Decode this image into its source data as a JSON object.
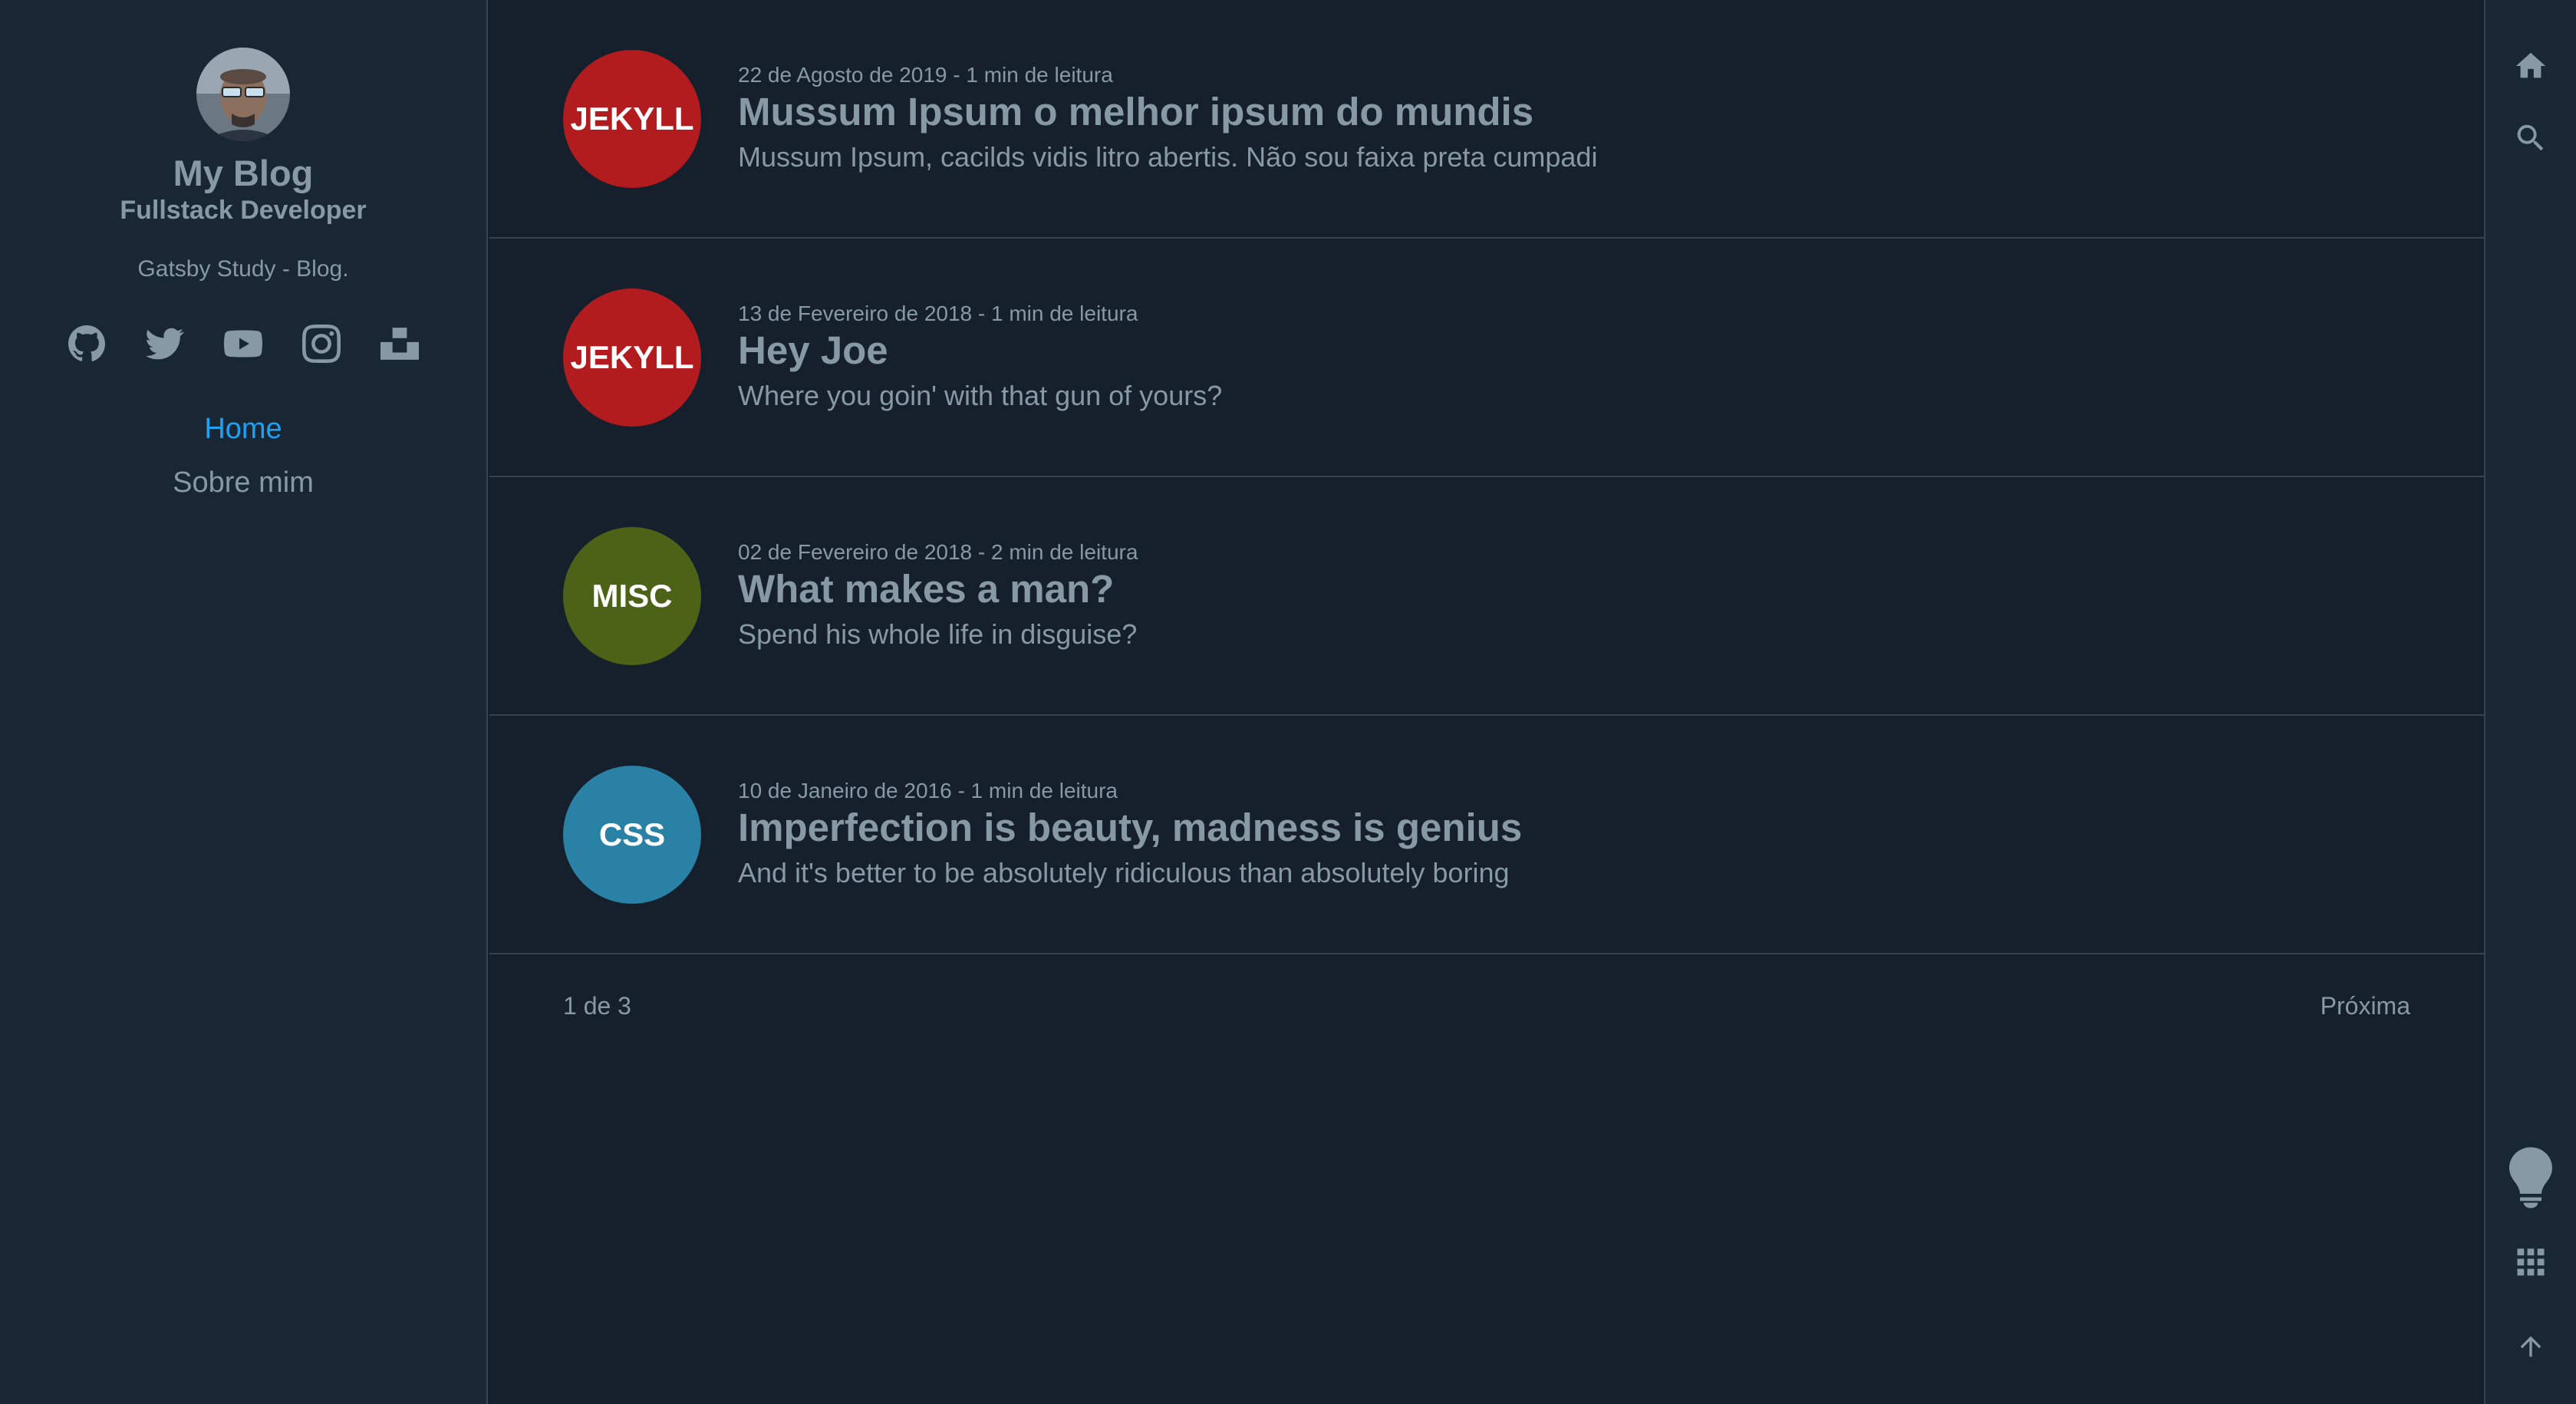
{
  "sidebar": {
    "title": "My Blog",
    "position": "Fullstack Developer",
    "description": "Gatsby Study - Blog.",
    "social": [
      "github-icon",
      "twitter-icon",
      "youtube-icon",
      "instagram-icon",
      "unsplash-icon"
    ],
    "menu": [
      {
        "label": "Home",
        "active": true
      },
      {
        "label": "Sobre mim",
        "active": false
      }
    ]
  },
  "posts": [
    {
      "tag": "JEKYLL",
      "color": "#b21c1f",
      "date": "22 de Agosto de 2019 - 1 min de leitura",
      "title": "Mussum Ipsum o melhor ipsum do mundis",
      "description": "Mussum Ipsum, cacilds vidis litro abertis. Não sou faixa preta cumpadi"
    },
    {
      "tag": "JEKYLL",
      "color": "#b21c1f",
      "date": "13 de Fevereiro de 2018 - 1 min de leitura",
      "title": "Hey Joe",
      "description": "Where you goin' with that gun of yours?"
    },
    {
      "tag": "MISC",
      "color": "#4b6217",
      "date": "02 de Fevereiro de 2018 - 2 min de leitura",
      "title": "What makes a man?",
      "description": "Spend his whole life in disguise?"
    },
    {
      "tag": "CSS",
      "color": "#2981a6",
      "date": "10 de Janeiro de 2016 - 1 min de leitura",
      "title": "Imperfection is beauty, madness is genius",
      "description": "And it's better to be absolutely ridiculous than absolutely boring"
    }
  ],
  "pagination": {
    "page_info": "1 de 3",
    "next_label": "Próxima"
  },
  "menubar": {
    "top": [
      "home-icon",
      "search-icon"
    ],
    "bottom": [
      "lightbulb-icon",
      "grid-icon",
      "arrow-up-icon"
    ]
  },
  "colors": {
    "background": "#16202c",
    "sidebar": "#192734",
    "text": "#8899a6",
    "highlight": "#1fa1f2",
    "border": "#38444d"
  }
}
